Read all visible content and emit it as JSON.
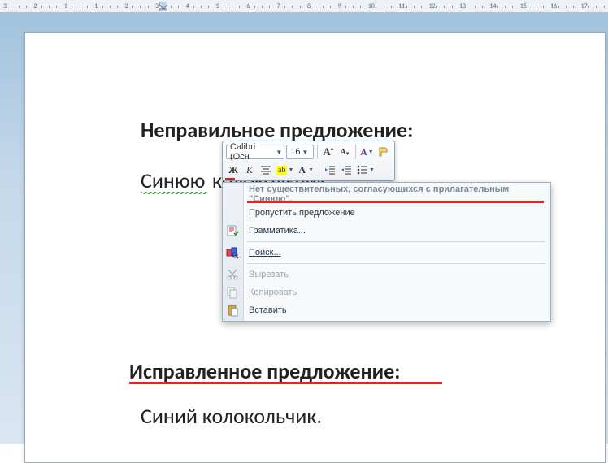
{
  "ruler": {
    "labels": [
      "3",
      "2",
      "1",
      "1",
      "2",
      "3",
      "4",
      "5",
      "6",
      "7",
      "8",
      "9",
      "10",
      "11",
      "12",
      "13",
      "14",
      "15",
      "16",
      "17"
    ]
  },
  "document": {
    "heading1": "Неправильное предложение:",
    "line1_left": "Синюю",
    "line1_right": "колокольчик.",
    "heading2": "Исправленное предложение:",
    "line2": "Синий колокольчик."
  },
  "mini_toolbar": {
    "font_name": "Calibri (Осн",
    "font_size": "16"
  },
  "context_menu": {
    "header": "Нет существительных, согласующихся с прилагательным \"Синюю\".",
    "skip": "Пропустить предложение",
    "grammar": "Грамматика...",
    "find": "Поиск...",
    "cut": "Вырезать",
    "copy": "Копировать",
    "paste": "Вставить"
  }
}
